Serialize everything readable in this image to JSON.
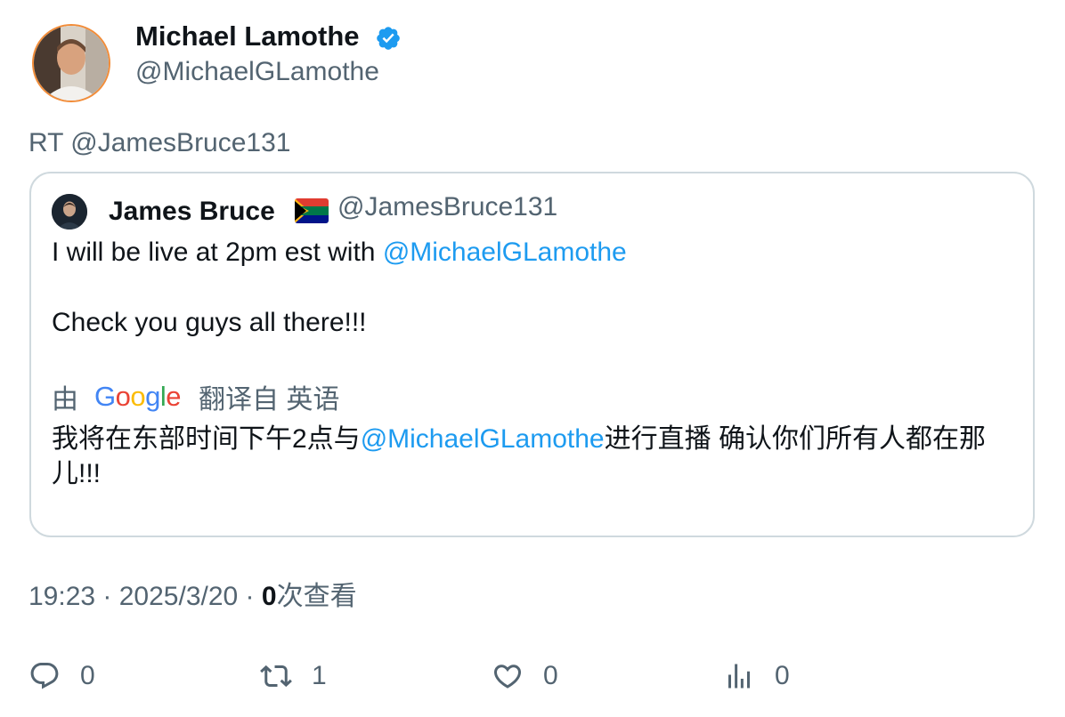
{
  "author": {
    "name": "Michael Lamothe",
    "handle": "@MichaelGLamothe",
    "verified_icon": "verified-badge-icon",
    "verified_color": "#1d9bf0"
  },
  "retweet_text": "RT @JamesBruce131",
  "quote": {
    "name": "James Bruce",
    "flag_icon": "south-africa-flag-icon",
    "handle": "@JamesBruce131",
    "line1_prefix": "I will be live at 2pm est with ",
    "line1_mention": "@MichaelGLamothe",
    "line2": "Check you guys all there!!!",
    "translation": {
      "by": "由",
      "google": [
        "G",
        "o",
        "o",
        "g",
        "l",
        "e"
      ],
      "from": "翻译自 英语",
      "text_prefix": "我将在东部时间下午2点与",
      "text_mention": "@MichaelGLamothe",
      "text_suffix": "进行直播 确认你们所有人都在那儿!!!"
    }
  },
  "meta": {
    "time": "19:23",
    "sep": " · ",
    "date": "2025/3/20",
    "views_count": "0",
    "views_label": "次查看"
  },
  "actions": {
    "reply": {
      "icon": "reply-icon",
      "count": "0"
    },
    "retweet": {
      "icon": "retweet-icon",
      "count": "1"
    },
    "like": {
      "icon": "heart-icon",
      "count": "0"
    },
    "views": {
      "icon": "analytics-icon",
      "count": "0"
    }
  },
  "colors": {
    "text": "#0f1419",
    "secondary": "#536471",
    "link": "#1d9bf0",
    "border": "#cfd9de",
    "avatar_ring": "#f28c38"
  }
}
